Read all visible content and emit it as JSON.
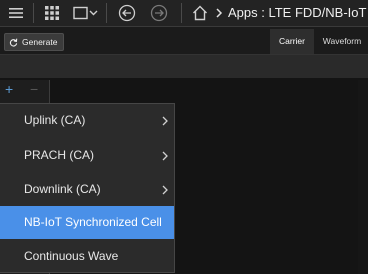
{
  "header": {
    "title": "Apps : LTE FDD/NB-IoT",
    "icons": [
      "menu-icon",
      "apps-grid-icon",
      "layout-dropdown-icon",
      "back-icon",
      "forward-icon",
      "home-icon",
      "breadcrumb-chevron-icon"
    ]
  },
  "toolbar": {
    "generate_label": "Generate",
    "tabs": [
      {
        "label": "Carrier",
        "active": true
      },
      {
        "label": "Waveform",
        "active": false
      }
    ]
  },
  "panel": {
    "add_label": "+",
    "remove_label": "−"
  },
  "menu": {
    "items": [
      {
        "label": "Uplink (CA)",
        "submenu": true,
        "selected": false
      },
      {
        "label": "PRACH (CA)",
        "submenu": true,
        "selected": false
      },
      {
        "label": "Downlink (CA)",
        "submenu": true,
        "selected": false
      },
      {
        "label": "NB-IoT Synchronized Cell",
        "submenu": false,
        "selected": true
      },
      {
        "label": "Continuous Wave",
        "submenu": false,
        "selected": false
      }
    ]
  },
  "colors": {
    "accent": "#4a90e8",
    "background": "#141414",
    "menu_background": "#2b2b2b"
  }
}
